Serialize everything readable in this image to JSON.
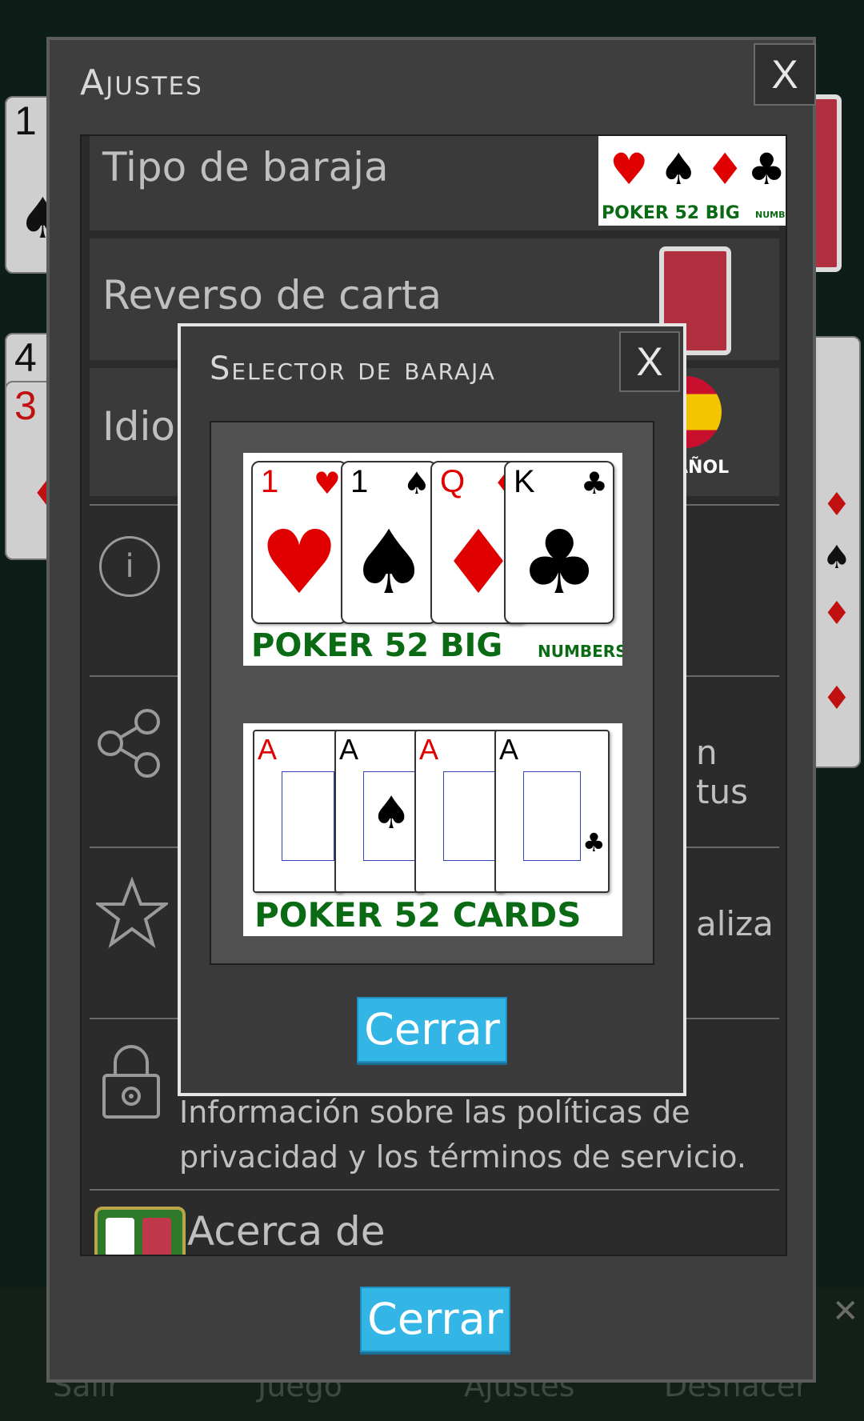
{
  "background": {
    "left_cards": [
      "1",
      "4",
      "3"
    ],
    "bottom_nav": [
      "Salir",
      "Juego",
      "Ajustes",
      "Deshacer"
    ]
  },
  "settings": {
    "title": "Ajustes",
    "close": "X",
    "deck_type_label": "Tipo de baraja",
    "deck_preview_text": "POKER 52 BIG",
    "deck_preview_small": "NUMBERS",
    "card_back_label": "Reverso de carta",
    "language_label": "Idioma",
    "language_value": "ESPAÑOL",
    "share_fragment": "n tus",
    "rate_fragment": "aliza",
    "privacy_text_line1": "Información sobre las políticas de",
    "privacy_text_line2": "privacidad y los términos de servicio.",
    "about_label": "Acerca de",
    "close_button": "Cerrar",
    "icons": [
      "info-icon",
      "share-icon",
      "star-icon",
      "lock-icon",
      "app-icon"
    ]
  },
  "selector": {
    "title": "Selector de baraja",
    "close": "X",
    "close_button": "Cerrar",
    "options": [
      {
        "caption": "POKER 52 BIG",
        "caption_small": "NUMBERS",
        "cards": [
          {
            "rank": "1",
            "suit": "♥",
            "color": "#e00000"
          },
          {
            "rank": "1",
            "suit": "♠",
            "color": "#000000"
          },
          {
            "rank": "Q",
            "suit": "♦",
            "color": "#e00000"
          },
          {
            "rank": "K",
            "suit": "♣",
            "color": "#000000"
          }
        ]
      },
      {
        "caption": "POKER 52 CARDS",
        "cards": [
          {
            "rank": "A",
            "suit": "♥",
            "color": "#e00000"
          },
          {
            "rank": "A",
            "suit": "♠",
            "color": "#000000"
          },
          {
            "rank": "A",
            "suit": "♦",
            "color": "#e00000"
          },
          {
            "rank": "A",
            "suit": "♣",
            "color": "#000000"
          }
        ]
      }
    ]
  }
}
